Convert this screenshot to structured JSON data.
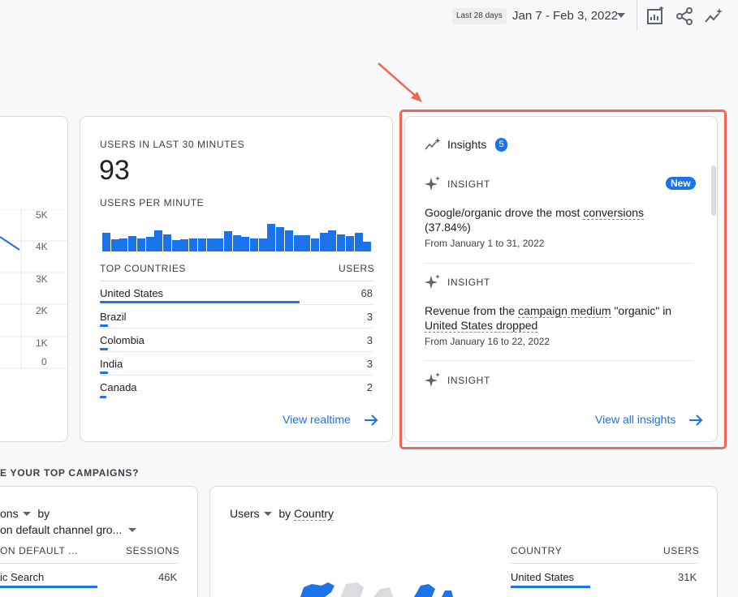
{
  "header": {
    "range_chip": "Last 28 days",
    "date_range": "Jan 7 - Feb 3, 2022",
    "icons": [
      "customize-report-icon",
      "share-icon",
      "insights-icon"
    ]
  },
  "left_card": {
    "axis": [
      "5K",
      "4K",
      "3K",
      "2K",
      "1K",
      "0"
    ]
  },
  "realtime": {
    "title": "USERS IN LAST 30 MINUTES",
    "count": "93",
    "per_minute_label": "USERS PER MINUTE",
    "bars": [
      22,
      15,
      16,
      18,
      16,
      17,
      25,
      20,
      14,
      15,
      16,
      16,
      16,
      16,
      24,
      19,
      17,
      16,
      16,
      33,
      29,
      25,
      19,
      19,
      16,
      22,
      25,
      20,
      18,
      22,
      12
    ],
    "table_headers": [
      "TOP COUNTRIES",
      "USERS"
    ],
    "countries": [
      {
        "name": "United States",
        "value": "68",
        "share": 1.0
      },
      {
        "name": "Brazil",
        "value": "3",
        "share": 0.04
      },
      {
        "name": "Colombia",
        "value": "3",
        "share": 0.04
      },
      {
        "name": "India",
        "value": "3",
        "share": 0.04
      },
      {
        "name": "Canada",
        "value": "2",
        "share": 0.03
      }
    ],
    "link": "View realtime"
  },
  "insights": {
    "title": "Insights",
    "count": "5",
    "items": [
      {
        "label": "INSIGHT",
        "badge": "New",
        "text_a": "Google/organic drove the most ",
        "text_link": "conversions",
        "text_b": "(37.84%)",
        "date": "From January 1 to 31, 2022"
      },
      {
        "label": "INSIGHT",
        "text_a": "Revenue from the ",
        "text_link": "campaign medium",
        "text_b": " \"organic\" in",
        "text_c": "United States dropped",
        "date": "From January 16 to 22, 2022"
      },
      {
        "label": "INSIGHT"
      }
    ],
    "link": "View all insights"
  },
  "campaigns": {
    "section_title": "E YOUR TOP CAMPAIGNS?",
    "selector_a": "ons",
    "by": "by",
    "selector_b": "on default channel gro...",
    "col_a": "ON DEFAULT ...",
    "col_b": "SESSIONS",
    "row_name": "ic Search",
    "row_value": "46K"
  },
  "country_card": {
    "metric": "Users",
    "by": "by",
    "dimension": "Country",
    "col_a": "COUNTRY",
    "col_b": "USERS",
    "row_name": "United States",
    "row_value": "31K"
  },
  "colors": {
    "accent": "#1a73e8",
    "highlight": "#ee6a55"
  }
}
